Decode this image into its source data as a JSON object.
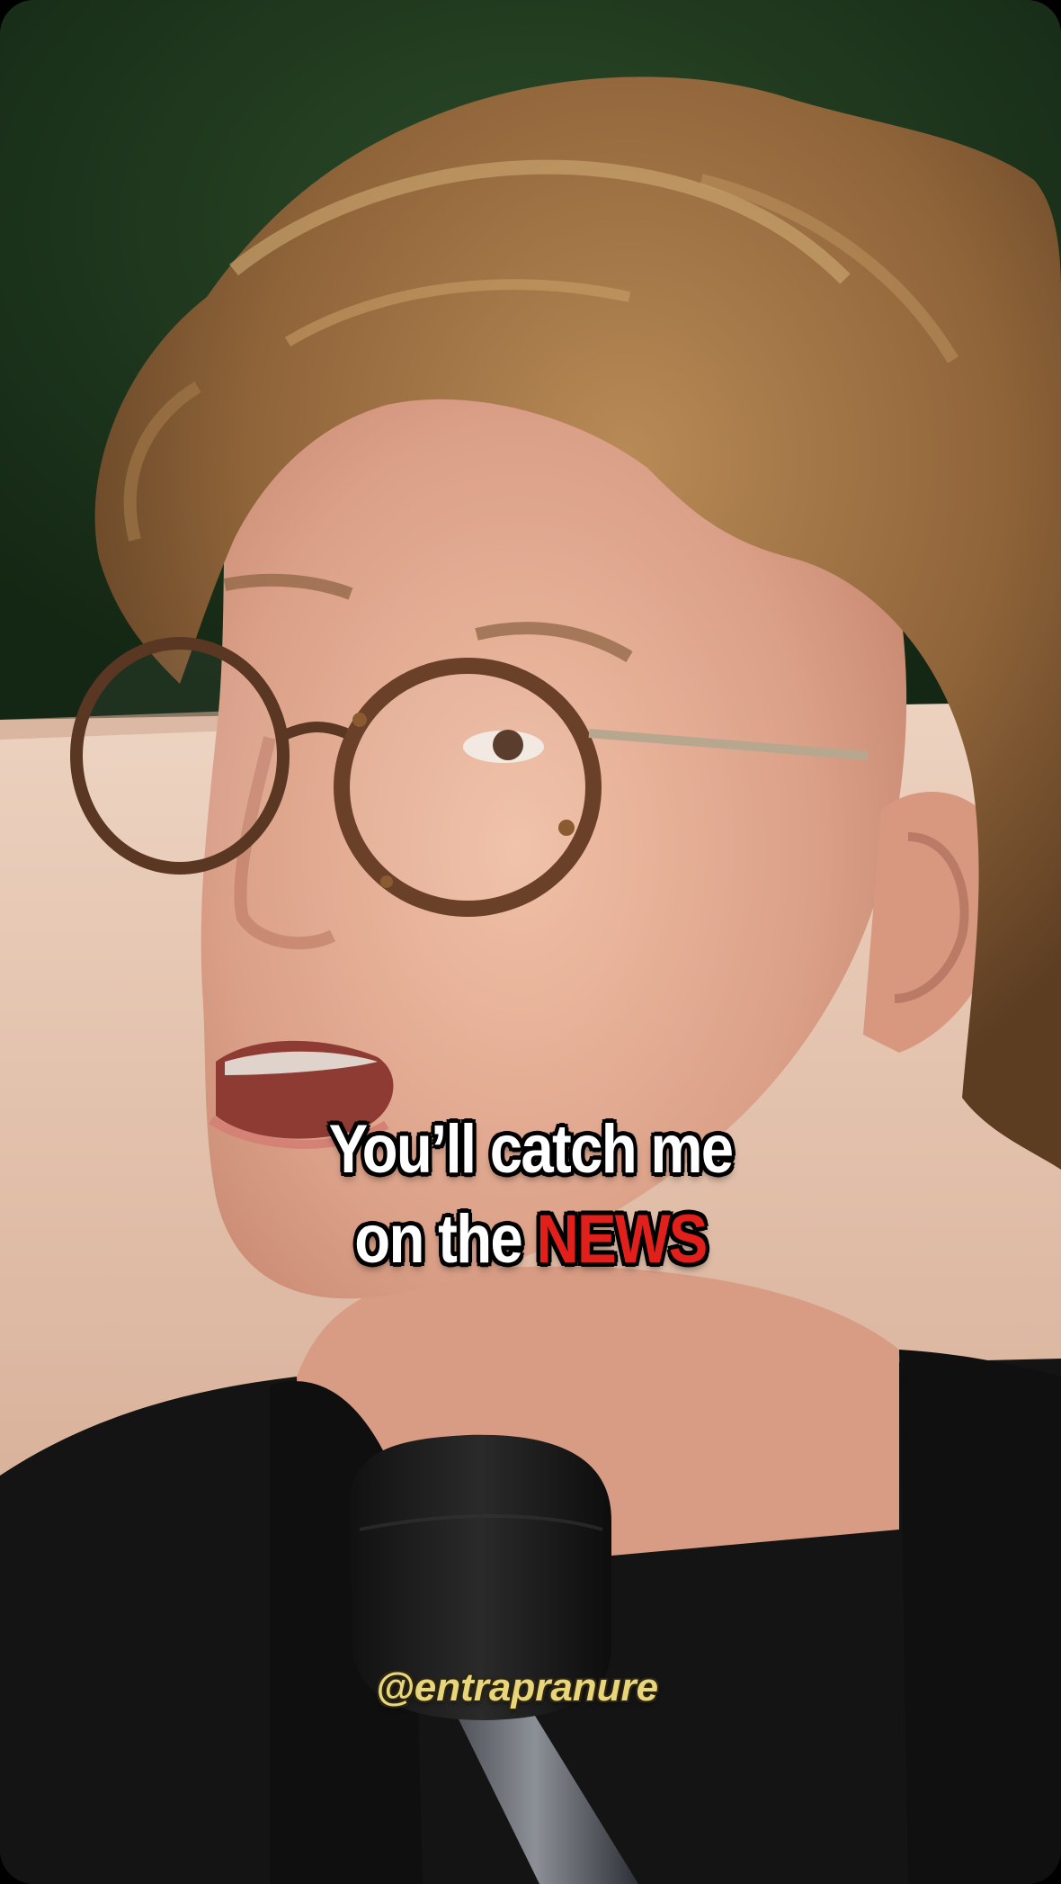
{
  "video": {
    "caption": {
      "line1": "You’ll catch me",
      "line2_prefix": "on the ",
      "line2_highlight": "NEWS"
    },
    "watermark_handle": "@entrapranure",
    "colors": {
      "caption_text": "#ffffff",
      "caption_highlight": "#e1201c",
      "caption_outline": "#000000",
      "handle_text": "#e9d67a",
      "background_foliage": "#1f3a1f",
      "wall": "#e6c3ad",
      "shirt": "#141414",
      "hair": "#9a7144",
      "skin": "#e2a78d"
    }
  }
}
